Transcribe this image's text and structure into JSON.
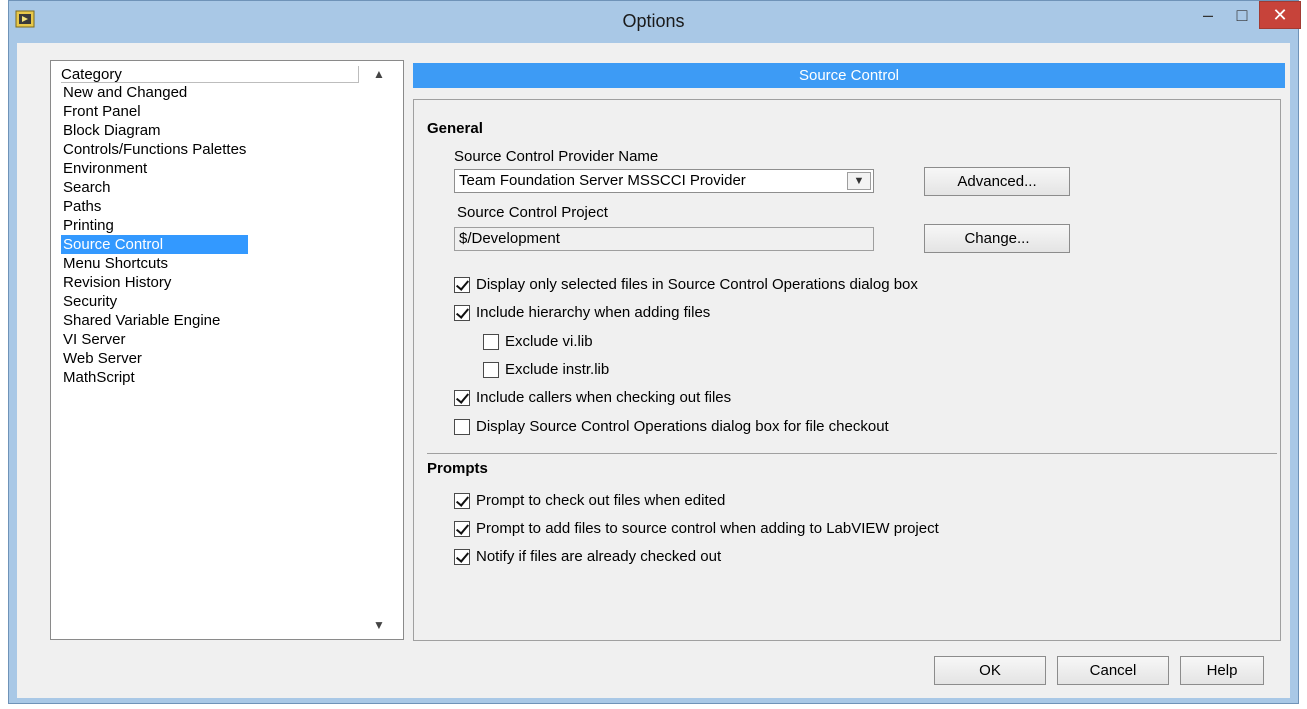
{
  "window": {
    "title": "Options",
    "minimize": "–",
    "maximize": "□",
    "close": "✕"
  },
  "category": {
    "header": "Category",
    "items": [
      "New and Changed",
      "Front Panel",
      "Block Diagram",
      "Controls/Functions Palettes",
      "Environment",
      "Search",
      "Paths",
      "Printing",
      "Source Control",
      "Menu Shortcuts",
      "Revision History",
      "Security",
      "Shared Variable Engine",
      "VI Server",
      "Web Server",
      "MathScript"
    ],
    "selected": "Source Control"
  },
  "section": {
    "title": "Source Control"
  },
  "general": {
    "title": "General",
    "provider_label": "Source Control Provider Name",
    "provider_value": "Team Foundation Server MSSCCI Provider",
    "advanced_label": "Advanced...",
    "project_label": "Source Control Project",
    "project_value": "$/Development",
    "change_label": "Change...",
    "options": [
      {
        "label": "Display only selected files in Source Control Operations dialog box",
        "checked": true
      },
      {
        "label": "Include hierarchy when adding files",
        "checked": true
      },
      {
        "label": "Exclude vi.lib",
        "checked": false
      },
      {
        "label": "Exclude instr.lib",
        "checked": false
      },
      {
        "label": "Include callers when checking out files",
        "checked": true
      },
      {
        "label": "Display Source Control Operations dialog box for file checkout",
        "checked": false
      }
    ]
  },
  "prompts": {
    "title": "Prompts",
    "options": [
      {
        "label": "Prompt to check out files when edited",
        "checked": true
      },
      {
        "label": "Prompt to add files to source control when adding to LabVIEW project",
        "checked": true
      },
      {
        "label": "Notify if files are already checked out",
        "checked": true
      }
    ]
  },
  "buttons": {
    "ok": "OK",
    "cancel": "Cancel",
    "help": "Help"
  },
  "colors": {
    "accent": "#3d9bf5",
    "selection": "#3399ff",
    "close": "#c7433a"
  }
}
